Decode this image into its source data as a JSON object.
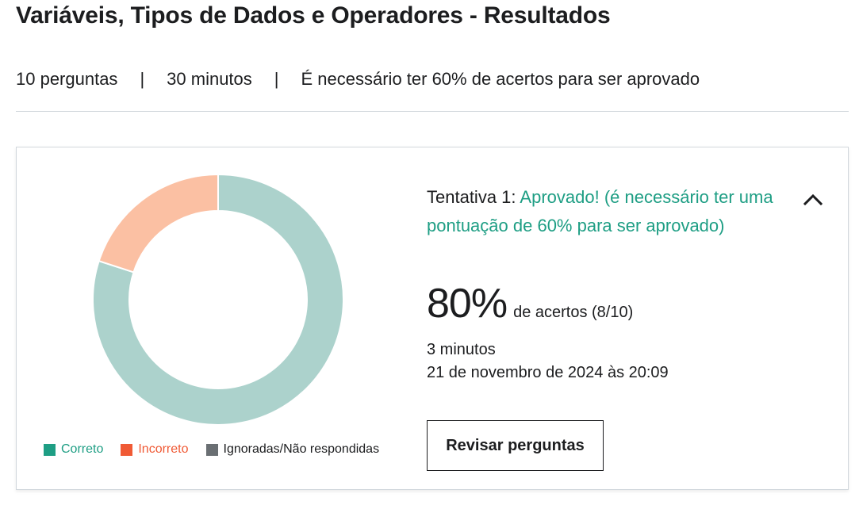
{
  "page": {
    "title": "Variáveis, Tipos de Dados e Operadores - Resultados",
    "meta": {
      "questions": "10 perguntas",
      "separator": "|",
      "time": "30 minutos",
      "requirement": "É necessário ter 60% de acertos para ser aprovado"
    }
  },
  "result": {
    "attempt_label": "Tentativa 1:",
    "status_text": "Aprovado! (é necessário ter uma pontuação de 60% para ser aprovado)",
    "score": "80%",
    "score_label": "de acertos (8/10)",
    "duration": "3 minutos",
    "datetime": "21 de novembro de 2024 às 20:09",
    "review_button": "Revisar perguntas",
    "collapse_icon": "chevron-up-icon"
  },
  "chart_data": {
    "type": "pie",
    "donut": true,
    "categories": [
      "Correto",
      "Incorreto",
      "Ignoradas/Não respondidas"
    ],
    "values": [
      8,
      2,
      0
    ],
    "colors": [
      "#acd2cc",
      "#fbc0a3",
      "#c4c6c8"
    ],
    "legend_colors": [
      "#1e9e84",
      "#f05a35",
      "#6a6f73"
    ],
    "legend_text_colors": [
      "#1e9e84",
      "#f05a35",
      "#1c1d1f"
    ],
    "legend_position": "bottom"
  },
  "colors": {
    "accent_green": "#1e9e84",
    "text": "#1c1d1f",
    "border": "#d1d7dc"
  }
}
